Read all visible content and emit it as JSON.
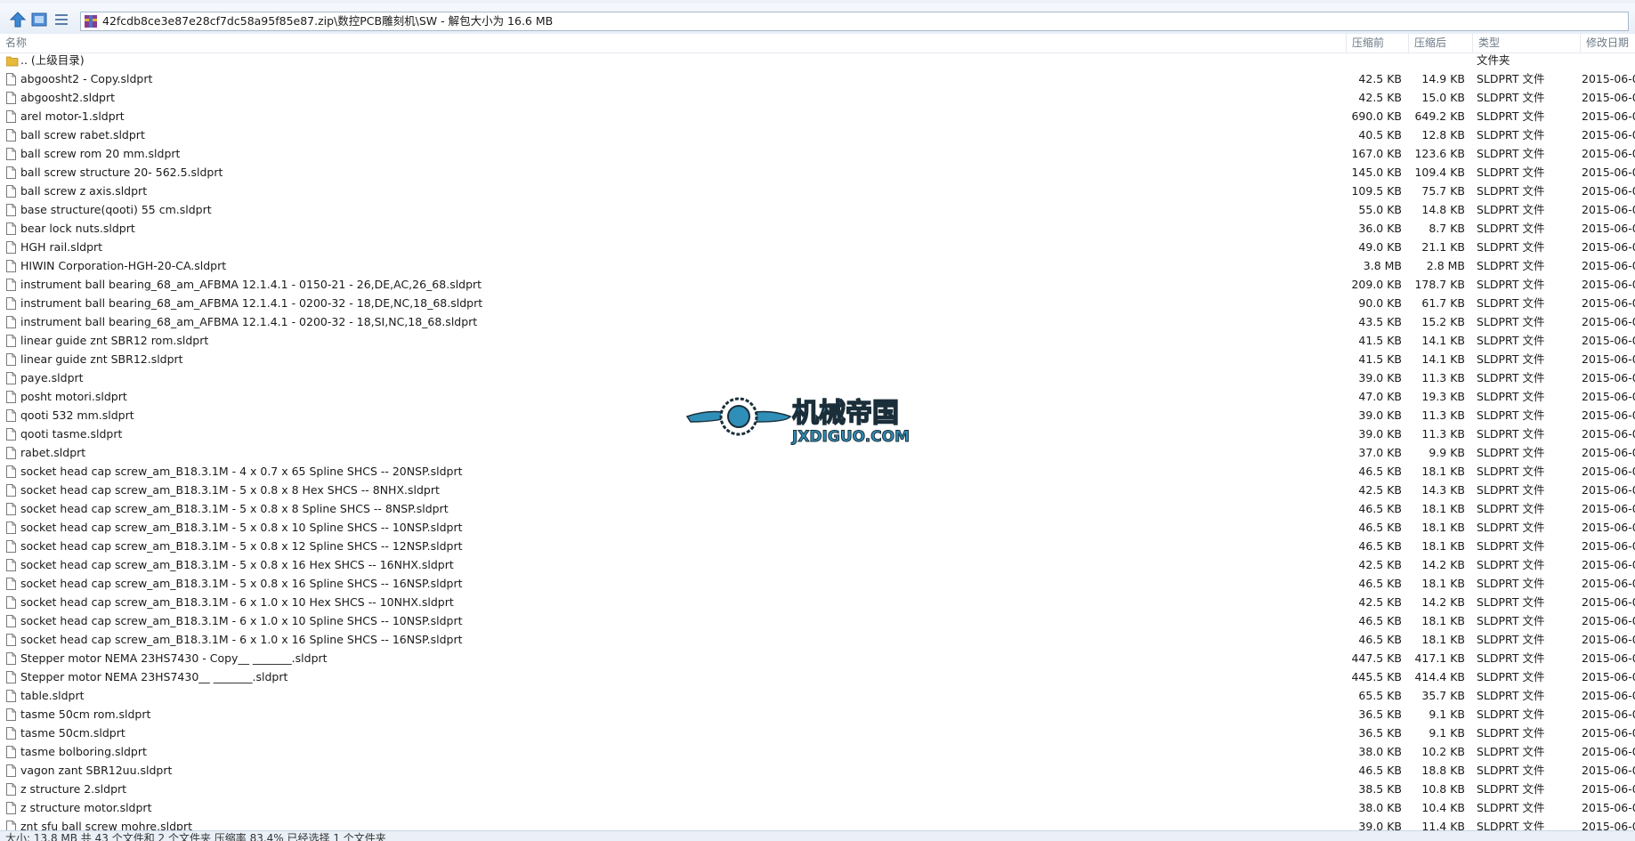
{
  "address": {
    "path": "42fcdb8ce3e87e28cf7dc58a95f85e87.zip\\数控PCB雕刻机\\SW - 解包大小为 16.6 MB"
  },
  "columns": {
    "name": "名称",
    "packed": "压缩前",
    "unpacked": "压缩后",
    "type": "类型",
    "date": "修改日期"
  },
  "parent_row": {
    "name": ".. (上级目录)",
    "type": "文件夹"
  },
  "files": [
    {
      "name": "abgoosht2 - Copy.sldprt",
      "packed": "42.5 KB",
      "unpacked": "14.9 KB",
      "type": "SLDPRT 文件",
      "date": "2015-06-0"
    },
    {
      "name": "abgoosht2.sldprt",
      "packed": "42.5 KB",
      "unpacked": "15.0 KB",
      "type": "SLDPRT 文件",
      "date": "2015-06-0"
    },
    {
      "name": "arel motor-1.sldprt",
      "packed": "690.0 KB",
      "unpacked": "649.2 KB",
      "type": "SLDPRT 文件",
      "date": "2015-06-0"
    },
    {
      "name": "ball screw rabet.sldprt",
      "packed": "40.5 KB",
      "unpacked": "12.8 KB",
      "type": "SLDPRT 文件",
      "date": "2015-06-0"
    },
    {
      "name": "ball screw rom 20 mm.sldprt",
      "packed": "167.0 KB",
      "unpacked": "123.6 KB",
      "type": "SLDPRT 文件",
      "date": "2015-06-0"
    },
    {
      "name": "ball screw structure 20- 562.5.sldprt",
      "packed": "145.0 KB",
      "unpacked": "109.4 KB",
      "type": "SLDPRT 文件",
      "date": "2015-06-0"
    },
    {
      "name": "ball screw z axis.sldprt",
      "packed": "109.5 KB",
      "unpacked": "75.7 KB",
      "type": "SLDPRT 文件",
      "date": "2015-06-0"
    },
    {
      "name": "base structure(qooti) 55 cm.sldprt",
      "packed": "55.0 KB",
      "unpacked": "14.8 KB",
      "type": "SLDPRT 文件",
      "date": "2015-06-0"
    },
    {
      "name": "bear lock nuts.sldprt",
      "packed": "36.0 KB",
      "unpacked": "8.7 KB",
      "type": "SLDPRT 文件",
      "date": "2015-06-0"
    },
    {
      "name": "HGH rail.sldprt",
      "packed": "49.0 KB",
      "unpacked": "21.1 KB",
      "type": "SLDPRT 文件",
      "date": "2015-06-0"
    },
    {
      "name": "HIWIN Corporation-HGH-20-CA.sldprt",
      "packed": "3.8 MB",
      "unpacked": "2.8 MB",
      "type": "SLDPRT 文件",
      "date": "2015-06-0"
    },
    {
      "name": "instrument ball bearing_68_am_AFBMA 12.1.4.1 - 0150-21 - 26,DE,AC,26_68.sldprt",
      "packed": "209.0 KB",
      "unpacked": "178.7 KB",
      "type": "SLDPRT 文件",
      "date": "2015-06-0"
    },
    {
      "name": "instrument ball bearing_68_am_AFBMA 12.1.4.1 - 0200-32 - 18,DE,NC,18_68.sldprt",
      "packed": "90.0 KB",
      "unpacked": "61.7 KB",
      "type": "SLDPRT 文件",
      "date": "2015-06-0"
    },
    {
      "name": "instrument ball bearing_68_am_AFBMA 12.1.4.1 - 0200-32 - 18,SI,NC,18_68.sldprt",
      "packed": "43.5 KB",
      "unpacked": "15.2 KB",
      "type": "SLDPRT 文件",
      "date": "2015-06-0"
    },
    {
      "name": "linear guide znt SBR12 rom.sldprt",
      "packed": "41.5 KB",
      "unpacked": "14.1 KB",
      "type": "SLDPRT 文件",
      "date": "2015-06-0"
    },
    {
      "name": "linear guide znt SBR12.sldprt",
      "packed": "41.5 KB",
      "unpacked": "14.1 KB",
      "type": "SLDPRT 文件",
      "date": "2015-06-0"
    },
    {
      "name": "paye.sldprt",
      "packed": "39.0 KB",
      "unpacked": "11.3 KB",
      "type": "SLDPRT 文件",
      "date": "2015-06-0"
    },
    {
      "name": "posht motori.sldprt",
      "packed": "47.0 KB",
      "unpacked": "19.3 KB",
      "type": "SLDPRT 文件",
      "date": "2015-06-0"
    },
    {
      "name": "qooti 532 mm.sldprt",
      "packed": "39.0 KB",
      "unpacked": "11.3 KB",
      "type": "SLDPRT 文件",
      "date": "2015-06-0"
    },
    {
      "name": "qooti tasme.sldprt",
      "packed": "39.0 KB",
      "unpacked": "11.3 KB",
      "type": "SLDPRT 文件",
      "date": "2015-06-0"
    },
    {
      "name": "rabet.sldprt",
      "packed": "37.0 KB",
      "unpacked": "9.9 KB",
      "type": "SLDPRT 文件",
      "date": "2015-06-0"
    },
    {
      "name": "socket head cap screw_am_B18.3.1M - 4 x 0.7 x 65 Spline SHCS -- 20NSP.sldprt",
      "packed": "46.5 KB",
      "unpacked": "18.1 KB",
      "type": "SLDPRT 文件",
      "date": "2015-06-0"
    },
    {
      "name": "socket head cap screw_am_B18.3.1M - 5 x 0.8 x 8 Hex SHCS -- 8NHX.sldprt",
      "packed": "42.5 KB",
      "unpacked": "14.3 KB",
      "type": "SLDPRT 文件",
      "date": "2015-06-0"
    },
    {
      "name": "socket head cap screw_am_B18.3.1M - 5 x 0.8 x 8 Spline SHCS -- 8NSP.sldprt",
      "packed": "46.5 KB",
      "unpacked": "18.1 KB",
      "type": "SLDPRT 文件",
      "date": "2015-06-0"
    },
    {
      "name": "socket head cap screw_am_B18.3.1M - 5 x 0.8 x 10 Spline SHCS -- 10NSP.sldprt",
      "packed": "46.5 KB",
      "unpacked": "18.1 KB",
      "type": "SLDPRT 文件",
      "date": "2015-06-0"
    },
    {
      "name": "socket head cap screw_am_B18.3.1M - 5 x 0.8 x 12 Spline SHCS -- 12NSP.sldprt",
      "packed": "46.5 KB",
      "unpacked": "18.1 KB",
      "type": "SLDPRT 文件",
      "date": "2015-06-0"
    },
    {
      "name": "socket head cap screw_am_B18.3.1M - 5 x 0.8 x 16 Hex SHCS -- 16NHX.sldprt",
      "packed": "42.5 KB",
      "unpacked": "14.2 KB",
      "type": "SLDPRT 文件",
      "date": "2015-06-0"
    },
    {
      "name": "socket head cap screw_am_B18.3.1M - 5 x 0.8 x 16 Spline SHCS -- 16NSP.sldprt",
      "packed": "46.5 KB",
      "unpacked": "18.1 KB",
      "type": "SLDPRT 文件",
      "date": "2015-06-0"
    },
    {
      "name": "socket head cap screw_am_B18.3.1M - 6 x 1.0 x 10 Hex SHCS -- 10NHX.sldprt",
      "packed": "42.5 KB",
      "unpacked": "14.2 KB",
      "type": "SLDPRT 文件",
      "date": "2015-06-0"
    },
    {
      "name": "socket head cap screw_am_B18.3.1M - 6 x 1.0 x 10 Spline SHCS -- 10NSP.sldprt",
      "packed": "46.5 KB",
      "unpacked": "18.1 KB",
      "type": "SLDPRT 文件",
      "date": "2015-06-0"
    },
    {
      "name": "socket head cap screw_am_B18.3.1M - 6 x 1.0 x 16 Spline SHCS -- 16NSP.sldprt",
      "packed": "46.5 KB",
      "unpacked": "18.1 KB",
      "type": "SLDPRT 文件",
      "date": "2015-06-0"
    },
    {
      "name": "Stepper motor NEMA 23HS7430 - Copy__ _______.sldprt",
      "packed": "447.5 KB",
      "unpacked": "417.1 KB",
      "type": "SLDPRT 文件",
      "date": "2015-06-0"
    },
    {
      "name": "Stepper motor NEMA 23HS7430__ _______.sldprt",
      "packed": "445.5 KB",
      "unpacked": "414.4 KB",
      "type": "SLDPRT 文件",
      "date": "2015-06-0"
    },
    {
      "name": "table.sldprt",
      "packed": "65.5 KB",
      "unpacked": "35.7 KB",
      "type": "SLDPRT 文件",
      "date": "2015-06-0"
    },
    {
      "name": "tasme 50cm rom.sldprt",
      "packed": "36.5 KB",
      "unpacked": "9.1 KB",
      "type": "SLDPRT 文件",
      "date": "2015-06-0"
    },
    {
      "name": "tasme 50cm.sldprt",
      "packed": "36.5 KB",
      "unpacked": "9.1 KB",
      "type": "SLDPRT 文件",
      "date": "2015-06-0"
    },
    {
      "name": "tasme bolboring.sldprt",
      "packed": "38.0 KB",
      "unpacked": "10.2 KB",
      "type": "SLDPRT 文件",
      "date": "2015-06-0"
    },
    {
      "name": "vagon zant SBR12uu.sldprt",
      "packed": "46.5 KB",
      "unpacked": "18.8 KB",
      "type": "SLDPRT 文件",
      "date": "2015-06-0"
    },
    {
      "name": "z structure 2.sldprt",
      "packed": "38.5 KB",
      "unpacked": "10.8 KB",
      "type": "SLDPRT 文件",
      "date": "2015-06-0"
    },
    {
      "name": "z structure motor.sldprt",
      "packed": "38.0 KB",
      "unpacked": "10.4 KB",
      "type": "SLDPRT 文件",
      "date": "2015-06-0"
    },
    {
      "name": "znt sfu ball screw mohre.sldprt",
      "packed": "39.0 KB",
      "unpacked": "11.4 KB",
      "type": "SLDPRT 文件",
      "date": "2015-06-0"
    }
  ],
  "watermark": {
    "cn_text": "机械帝国",
    "en_text": "JXDIGUO.COM"
  },
  "status_bar": {
    "text": "大小: 13.8 MB 共 43 个文件和 2 个文件夹 压缩率 83.4% 已经选择 1 个文件夹"
  },
  "colors": {
    "toolbar": "#e7eef7",
    "folder": "#e8b93a",
    "watermark_blue": "#2f8fb8"
  }
}
